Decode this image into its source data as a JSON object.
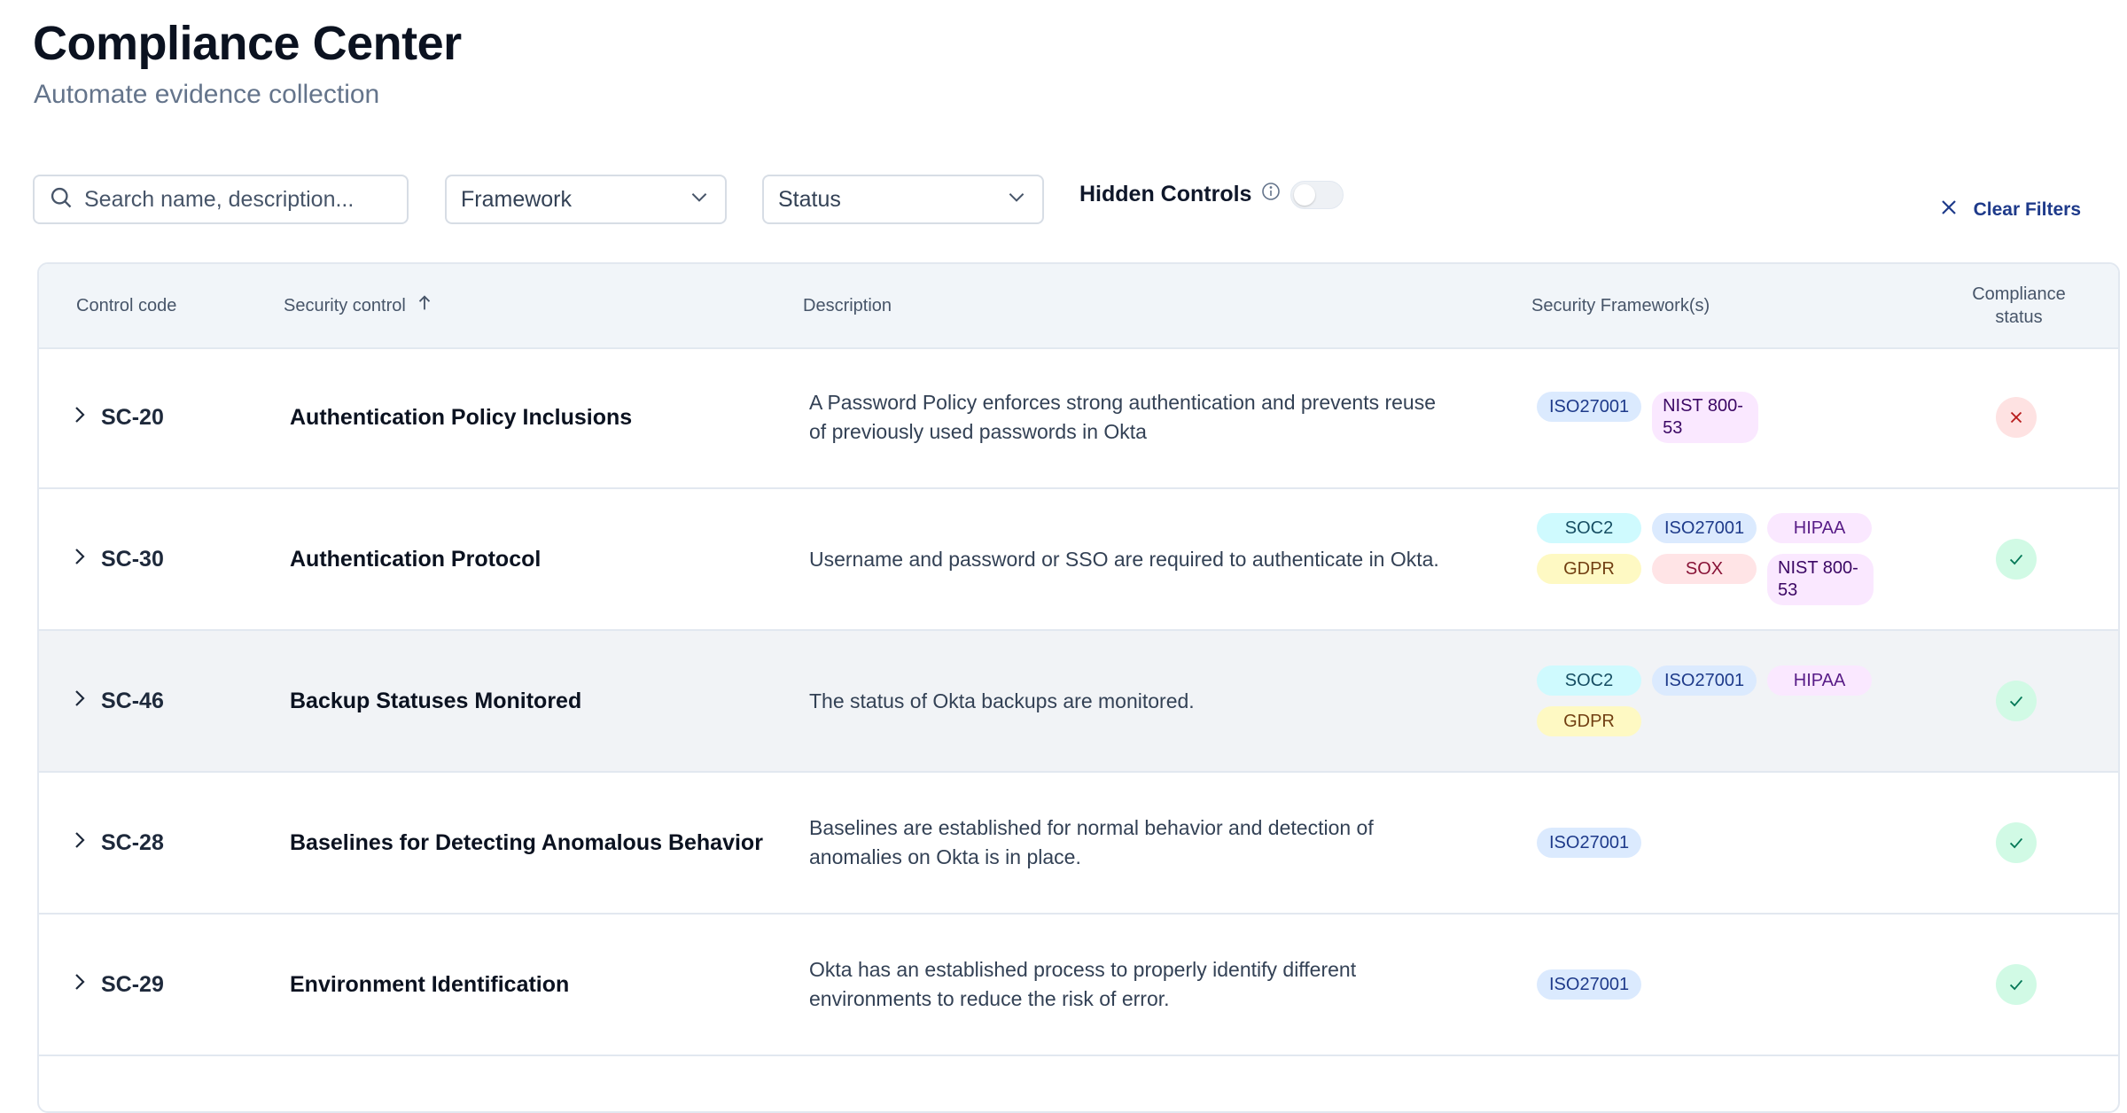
{
  "header": {
    "title": "Compliance Center",
    "subtitle": "Automate evidence collection"
  },
  "filters": {
    "search_placeholder": "Search name, description...",
    "framework_label": "Framework",
    "status_label": "Status",
    "hidden_controls_label": "Hidden Controls",
    "hidden_controls_enabled": false,
    "clear_label": "Clear Filters"
  },
  "table": {
    "columns": {
      "code": "Control code",
      "control": "Security control",
      "description": "Description",
      "frameworks": "Security Framework(s)",
      "status": "Compliance status"
    },
    "rows": [
      {
        "code": "SC-20",
        "control": "Authentication Policy Inclusions",
        "description": "A Password Policy enforces strong authentication and prevents reuse of previously used passwords in Okta",
        "frameworks": [
          "ISO27001",
          "NIST 800-53"
        ],
        "status": "non-compliant"
      },
      {
        "code": "SC-30",
        "control": "Authentication Protocol",
        "description": "Username and password or SSO are required to authenticate in Okta.",
        "frameworks": [
          "SOC2",
          "ISO27001",
          "HIPAA",
          "GDPR",
          "SOX",
          "NIST 800-53"
        ],
        "status": "compliant"
      },
      {
        "code": "SC-46",
        "control": "Backup Statuses Monitored",
        "description": "The status of Okta backups are monitored.",
        "frameworks": [
          "SOC2",
          "ISO27001",
          "HIPAA",
          "GDPR"
        ],
        "status": "compliant"
      },
      {
        "code": "SC-28",
        "control": "Baselines for Detecting Anomalous Behavior",
        "description": "Baselines are established for normal behavior and detection of anomalies on Okta is in place.",
        "frameworks": [
          "ISO27001"
        ],
        "status": "compliant"
      },
      {
        "code": "SC-29",
        "control": "Environment Identification",
        "description": "Okta has an established process to properly identify different environments to reduce the risk of error.",
        "frameworks": [
          "ISO27001"
        ],
        "status": "compliant"
      }
    ]
  },
  "icons": {
    "search": "search-icon",
    "dropdown": "chevron-down-icon",
    "info": "info-icon",
    "clear": "close-icon",
    "sort": "arrow-up-icon",
    "expand": "chevron-right-icon",
    "compliant": "check-icon",
    "non_compliant": "x-icon"
  },
  "colors": {
    "compliant_bg": "#d1fae5",
    "compliant_fg": "#047857",
    "non_compliant_bg": "#fee2e2",
    "non_compliant_fg": "#b91c1c",
    "accent": "#1e3a8a"
  }
}
